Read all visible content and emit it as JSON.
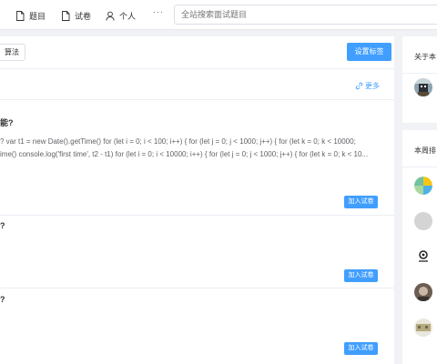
{
  "nav": {
    "items": [
      {
        "label": "题目",
        "icon": "document-icon"
      },
      {
        "label": "试卷",
        "icon": "document-icon"
      },
      {
        "label": "个人",
        "icon": "user-icon"
      }
    ],
    "more": "···"
  },
  "search": {
    "placeholder": "全站搜索面试题目"
  },
  "toolbar": {
    "tag": "算法",
    "set_tag_label": "设置标签"
  },
  "more_link": "更多",
  "questions": [
    {
      "title": "能?",
      "lines": [
        "?   var t1 = new Date().getTime() for (let i = 0; i < 100; i++) { for (let j = 0; j < 1000; j++) { for (let k = 0; k < 10000;",
        "ime() console.log('first time', t2 - t1) for (let i = 0; i < 10000; i++) { for (let j = 0; j < 1000; j++) { for (let k = 0; k < 10..."
      ],
      "add_label": "加入试卷"
    },
    {
      "title": "?",
      "lines": [],
      "add_label": "加入试卷"
    },
    {
      "title": "?",
      "lines": [],
      "add_label": "加入试卷"
    }
  ],
  "sidebar": {
    "about_title": "关于本",
    "ranking_title": "本周排"
  },
  "colors": {
    "accent": "#409eff"
  }
}
